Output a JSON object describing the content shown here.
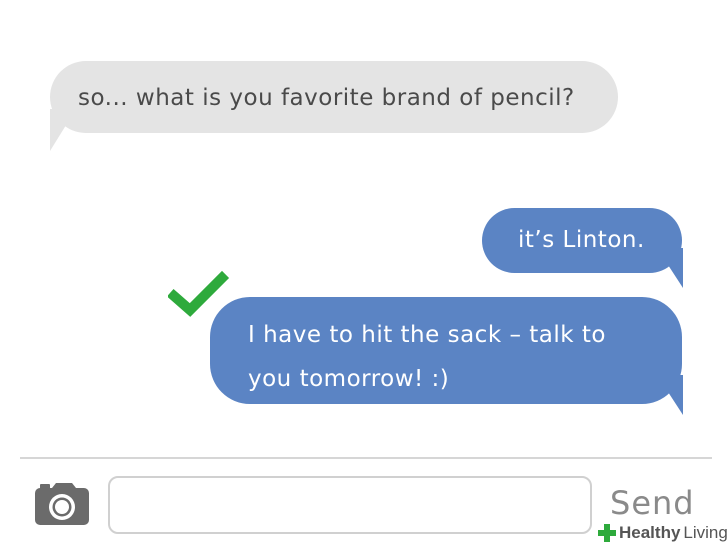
{
  "messages": [
    {
      "direction": "incoming",
      "text": "so... what is you favorite brand of pencil?"
    },
    {
      "direction": "outgoing",
      "text": "it’s Linton."
    },
    {
      "direction": "outgoing",
      "text": "I have to hit the sack – talk to you tomorrow! :)"
    }
  ],
  "composer": {
    "input_value": "",
    "send_label": "Send",
    "camera_icon": "camera-icon"
  },
  "markers": {
    "approval_icon": "checkmark-icon",
    "approval_color": "#2eaa3c"
  },
  "watermark": {
    "word1": "Healthy",
    "word2": "Living"
  },
  "colors": {
    "incoming_bubble": "#e4e4e4",
    "outgoing_bubble": "#5b84c4",
    "incoming_text": "#4a4a4a",
    "outgoing_text": "#ffffff"
  }
}
